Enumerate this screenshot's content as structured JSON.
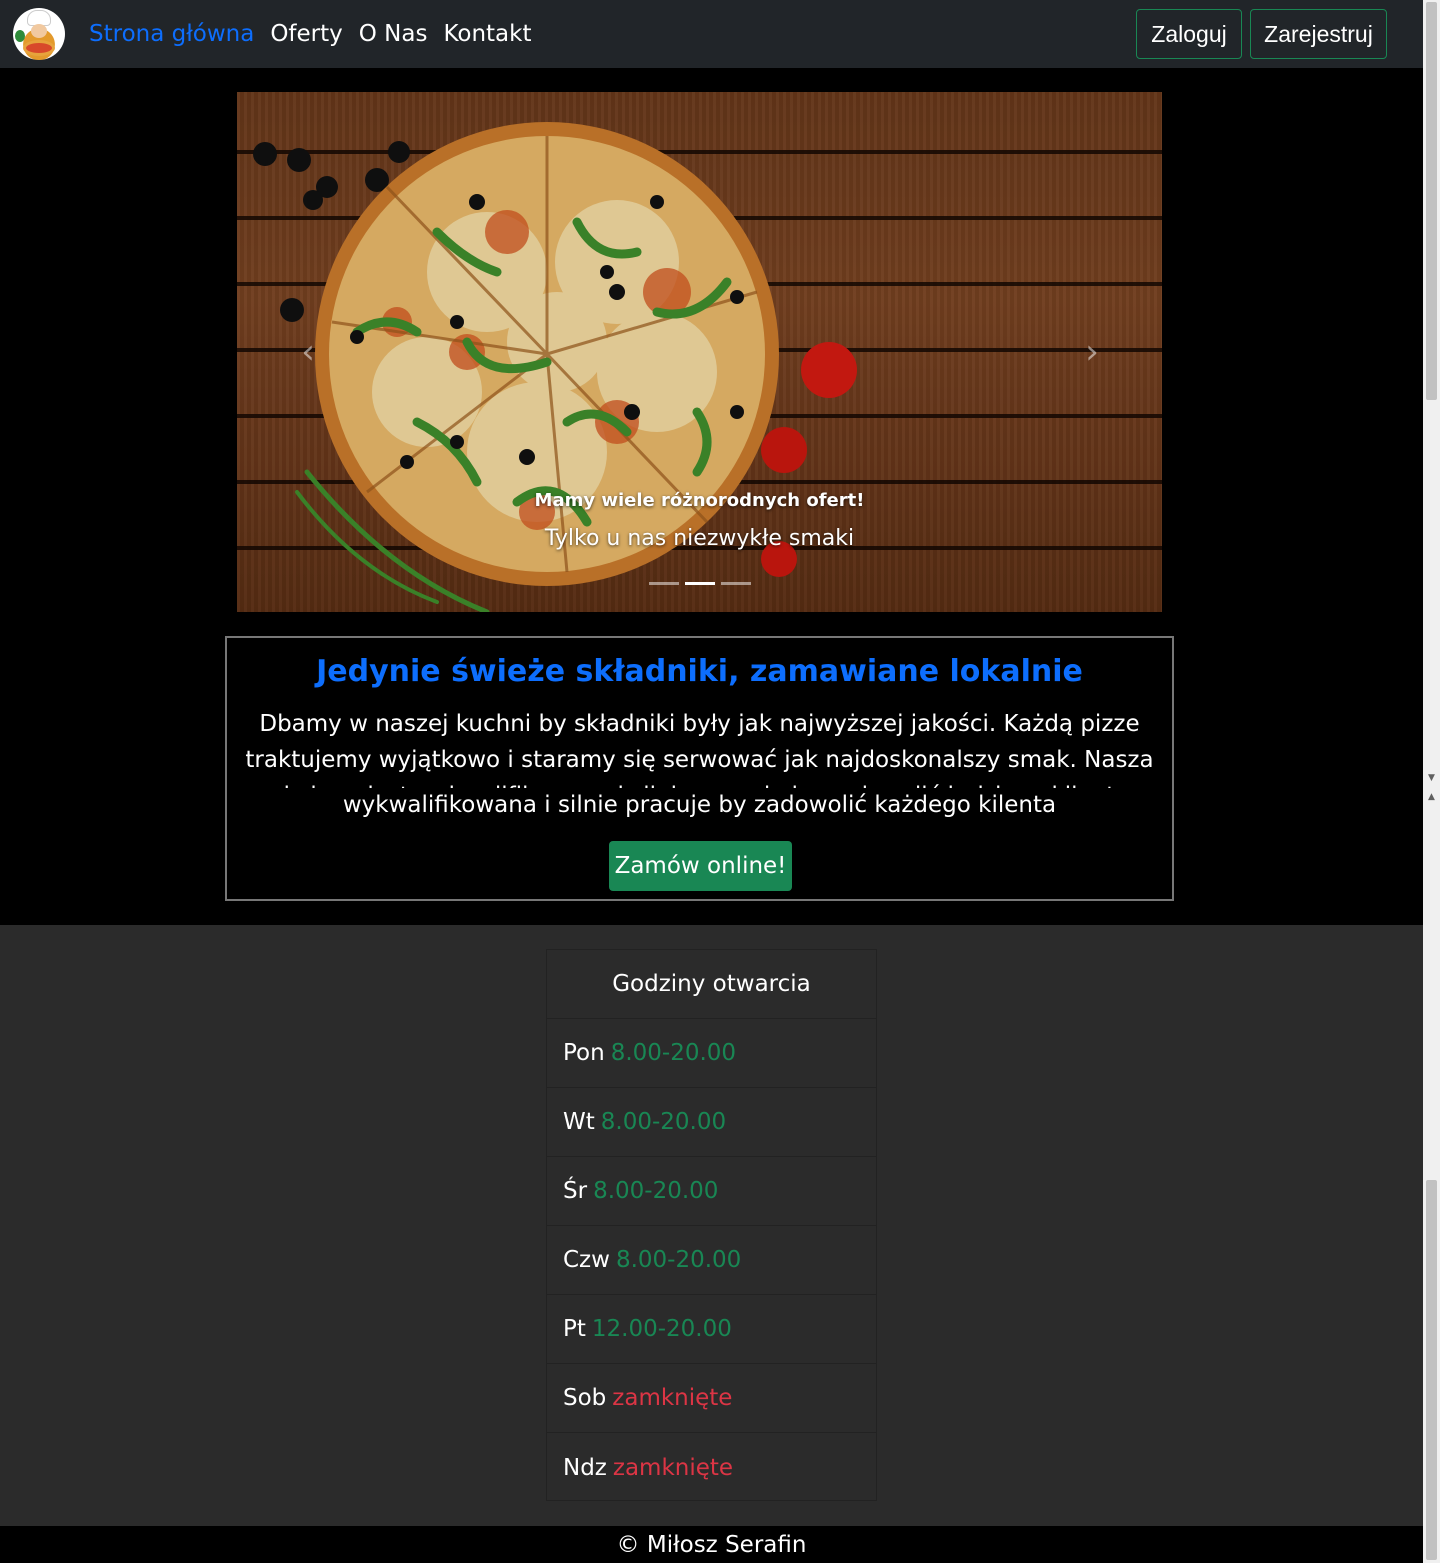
{
  "navbar": {
    "logo_icon": "chef-pizza-logo",
    "links": [
      {
        "label": "Strona główna",
        "active": true
      },
      {
        "label": "Oferty",
        "active": false
      },
      {
        "label": "O Nas",
        "active": false
      },
      {
        "label": "Kontakt",
        "active": false
      }
    ],
    "login_label": "Zaloguj",
    "register_label": "Zarejestruj"
  },
  "carousel": {
    "caption_title": "Mamy wiele różnorodnych ofert!",
    "caption_text": "Tylko u nas niezwykłe smaki",
    "prev_icon": "chevron-left-icon",
    "next_icon": "chevron-right-icon",
    "prev_glyph": "‹",
    "next_glyph": "›",
    "slide_count": 3,
    "active_slide": 2
  },
  "info": {
    "title": "Jedynie świeże składniki, zamawiane lokalnie",
    "text": "Dbamy w naszej kuchni by składniki były jak najwyższej jakości. Każdą pizze traktujemy wyjątkowo i staramy się serwować jak najdoskonalszy smak. Nasza obsługa jest wykwalifikowana i silnie pracuje by zadowolić każdego kilenta",
    "text_line3": "wykwalifikowana i silnie pracuje by zadowolić każdego kilenta",
    "order_label": "Zamów online!"
  },
  "hours": {
    "header": "Godziny otwarcia",
    "rows": [
      {
        "day": "Pon",
        "value": "8.00-20.00",
        "status": "open"
      },
      {
        "day": "Wt",
        "value": "8.00-20.00",
        "status": "open"
      },
      {
        "day": "Śr",
        "value": "8.00-20.00",
        "status": "open"
      },
      {
        "day": "Czw",
        "value": "8.00-20.00",
        "status": "open"
      },
      {
        "day": "Pt",
        "value": "12.00-20.00",
        "status": "open"
      },
      {
        "day": "Sob",
        "value": "zamknięte",
        "status": "closed"
      },
      {
        "day": "Ndz",
        "value": "zamknięte",
        "status": "closed"
      }
    ]
  },
  "footer": {
    "text": "© Miłosz Serafin"
  },
  "colors": {
    "accent": "#0d6efd",
    "success": "#198754",
    "danger": "#dc3545",
    "navbar_bg": "#212529",
    "page_bg": "#2b2b2b"
  }
}
